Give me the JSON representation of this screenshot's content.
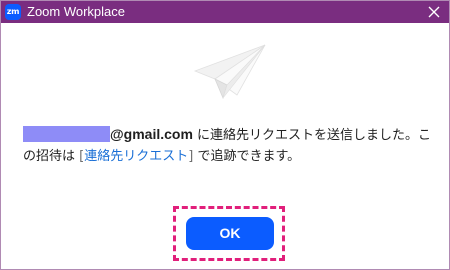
{
  "window": {
    "title": "Zoom Workplace",
    "app_icon_text": "zm",
    "titlebar_color": "#7a2d80",
    "close_icon": "close-icon"
  },
  "message": {
    "email_suffix": "@gmail.com",
    "line1_text": " に連絡先リクエストを送信しました。こ",
    "line2_prefix": "の招待は ",
    "bracket_open": "[",
    "link_text": "連絡先リクエスト",
    "bracket_close": "]",
    "line2_suffix": " で追跡できます。"
  },
  "ok_button": {
    "label": "OK",
    "color": "#0b5cff",
    "highlight_color": "#e11f7b"
  },
  "illustration": {
    "icon": "paper-plane-icon"
  }
}
